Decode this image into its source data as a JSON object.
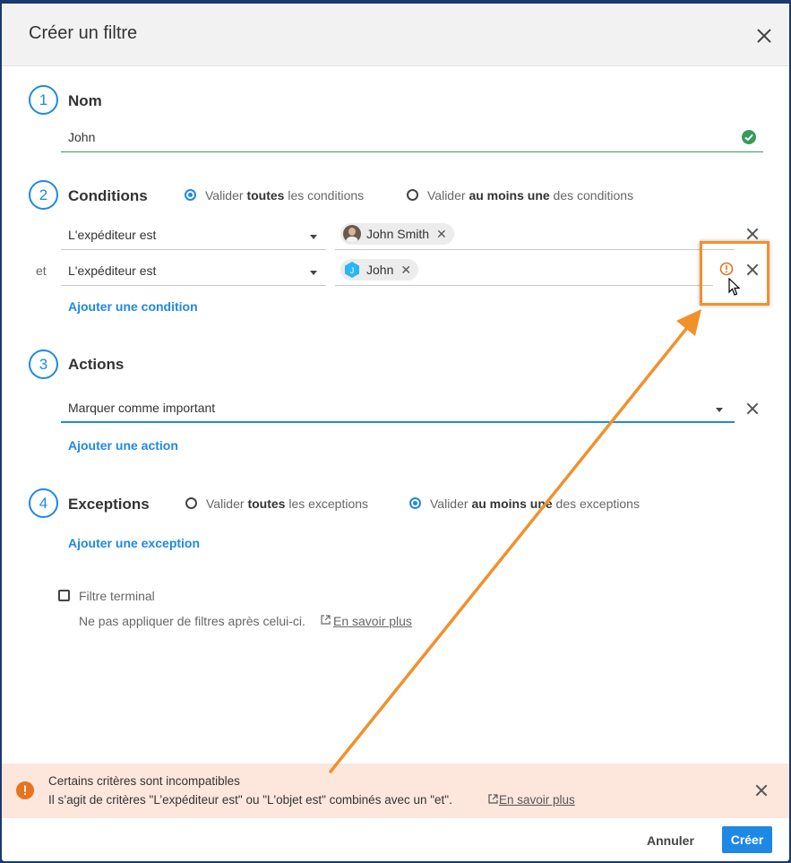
{
  "dialog": {
    "title": "Créer un filtre",
    "close_icon": "close-icon"
  },
  "steps": {
    "one": "1",
    "two": "2",
    "three": "3",
    "four": "4"
  },
  "name_section": {
    "title": "Nom",
    "value": "John",
    "valid_icon": "check-circle-icon"
  },
  "conditions": {
    "title": "Conditions",
    "mode_all_prefix": "Valider ",
    "mode_all_bold": "toutes",
    "mode_all_suffix": " les conditions",
    "mode_any_prefix": "Valider ",
    "mode_any_bold": "au moins une",
    "mode_any_suffix": " des conditions",
    "selected_mode": "all",
    "rows": [
      {
        "connector": "",
        "field": "L'expéditeur est",
        "chip": "John Smith"
      },
      {
        "connector": "et",
        "field": "L'expéditeur est",
        "chip": "John",
        "chip_avatar_letter": "J"
      }
    ],
    "add_link": "Ajouter une condition"
  },
  "actions": {
    "title": "Actions",
    "value": "Marquer comme important",
    "add_link": "Ajouter une action"
  },
  "exceptions": {
    "title": "Exceptions",
    "mode_all_prefix": "Valider ",
    "mode_all_bold": "toutes",
    "mode_all_suffix": " les exceptions",
    "mode_any_prefix": "Valider ",
    "mode_any_bold": "au moins une",
    "mode_any_suffix": " des exceptions",
    "selected_mode": "any",
    "add_link": "Ajouter une exception"
  },
  "terminal": {
    "label": "Filtre terminal",
    "checked": false,
    "help": "Ne pas appliquer de filtres après celui-ci.",
    "help_link": "En savoir plus"
  },
  "alert": {
    "title": "Certains critères sont incompatibles",
    "message": "Il s’agit de critères \"L’expéditeur est\" ou \"L'objet est\" combinés avec un \"et\".",
    "link": "En savoir plus"
  },
  "footer": {
    "cancel": "Annuler",
    "create": "Créer"
  },
  "colors": {
    "accent": "#1e88e5",
    "warning": "#e8731e",
    "success": "#3a9a5b",
    "annotation": "#f0912c"
  }
}
